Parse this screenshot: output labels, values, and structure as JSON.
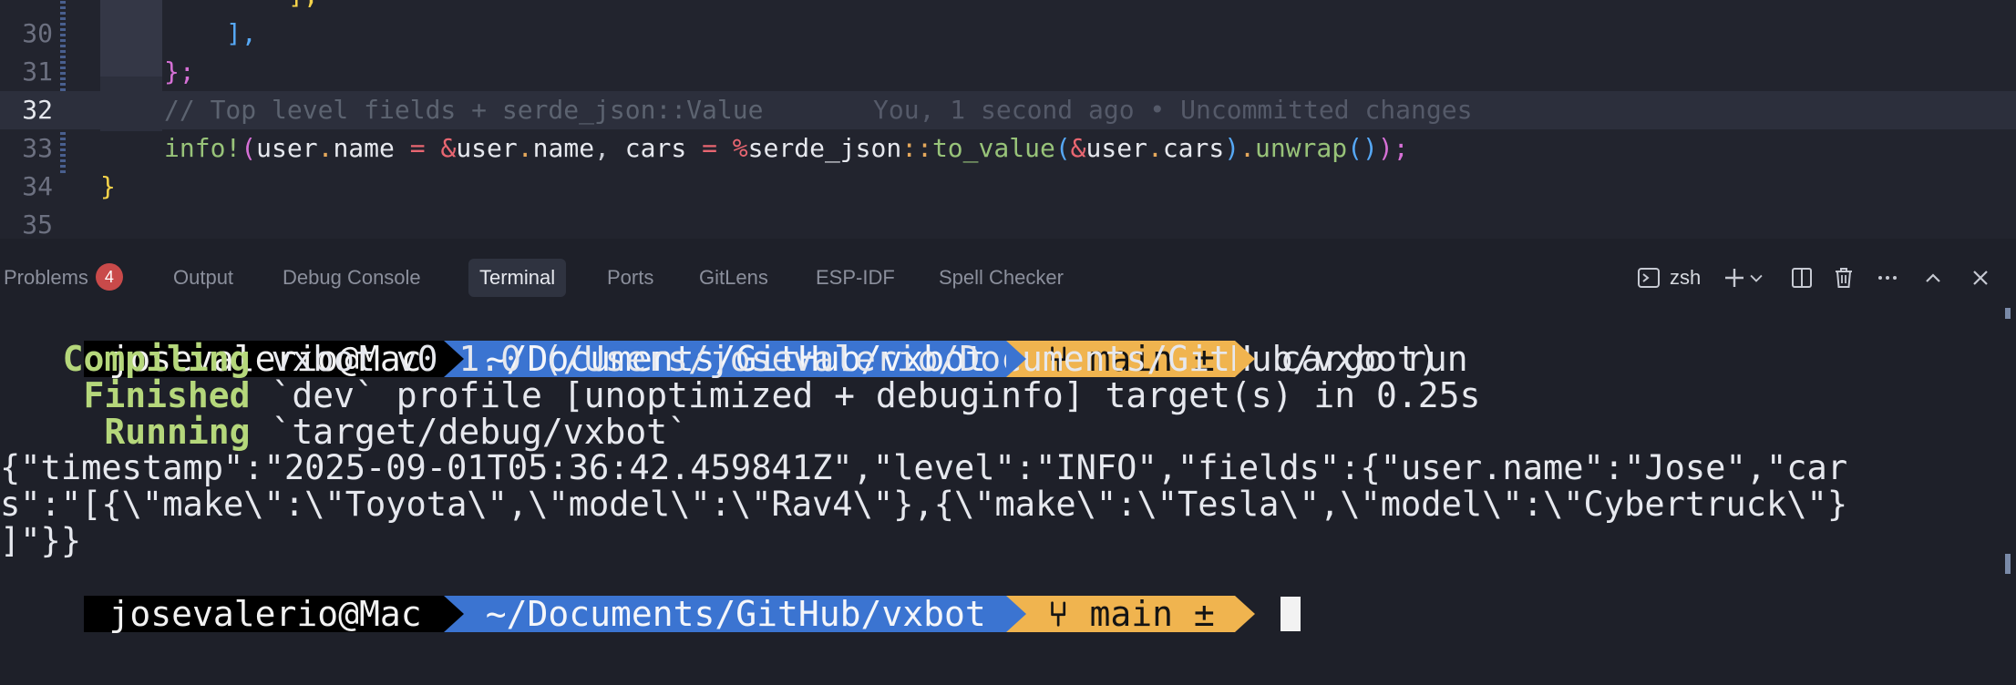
{
  "editor": {
    "lines": [
      {
        "number": "30",
        "text": "],"
      },
      {
        "number": "31",
        "text": "};"
      },
      {
        "number": "32",
        "comment": "// Top level fields + serde_json::Value",
        "blame": "You, 1 second ago • Uncommitted changes"
      },
      {
        "number": "33"
      },
      {
        "number": "34",
        "text": "}"
      },
      {
        "number": "35"
      }
    ],
    "line33": {
      "macro": "info!",
      "open": "(",
      "user1": "user",
      "dot": ".",
      "name1": "name",
      "eq": " = ",
      "amp": "&",
      "user2": "user",
      "name2": "name",
      "comma": ", ",
      "cars": "cars",
      "eq2": " = ",
      "pct": "%",
      "serde": "serde_json",
      "colons": "::",
      "to_value": "to_value",
      "open2": "(",
      "amp2": "&",
      "user3": "user",
      "cars2": "cars",
      "close2": ")",
      "unwrap": "unwrap",
      "open3": "()",
      "close": ");"
    }
  },
  "panel": {
    "tabs": [
      {
        "label": "Problems",
        "badge": "4"
      },
      {
        "label": "Output"
      },
      {
        "label": "Debug Console"
      },
      {
        "label": "Terminal",
        "active": true
      },
      {
        "label": "Ports"
      },
      {
        "label": "GitLens"
      },
      {
        "label": "ESP-IDF"
      },
      {
        "label": "Spell Checker"
      }
    ],
    "shell": "zsh",
    "icons": [
      "terminal-icon",
      "plus-icon",
      "chevron-down-icon",
      "split-icon",
      "trash-icon",
      "more-icon",
      "chevron-up-icon",
      "close-icon"
    ]
  },
  "terminal": {
    "prompt": {
      "user": "josevalerio@Mac",
      "path": "~/Documents/GitHub/vxbot",
      "branch": "main ±",
      "branch_icon": "git-branch-icon"
    },
    "command": "cargo run",
    "output": {
      "compiling_status": "Compiling",
      "compiling_text": "vxbot v0.1.0 (/Users/josevalerio/Documents/GitHub/vxbot)",
      "finished_status": "Finished",
      "finished_text": "`dev` profile [unoptimized + debuginfo] target(s) in 0.25s",
      "running_status": "Running",
      "running_text": "`target/debug/vxbot`",
      "json_line1": "{\"timestamp\":\"2025-09-01T05:36:42.459841Z\",\"level\":\"INFO\",\"fields\":{\"user.name\":\"Jose\",\"car",
      "json_line2": "s\":\"[{\\\"make\\\":\\\"Toyota\\\",\\\"model\\\":\\\"Rav4\\\"},{\\\"make\\\":\\\"Tesla\\\",\\\"model\\\":\\\"Cybertruck\\\"}",
      "json_line3": "]\"}}"
    }
  },
  "colors": {
    "prompt_user_bg": "#000000",
    "prompt_path_bg": "#3b74d1",
    "prompt_git_bg": "#f0b44f",
    "status_green": "#b5d77b",
    "badge_red": "#c94a4a"
  }
}
